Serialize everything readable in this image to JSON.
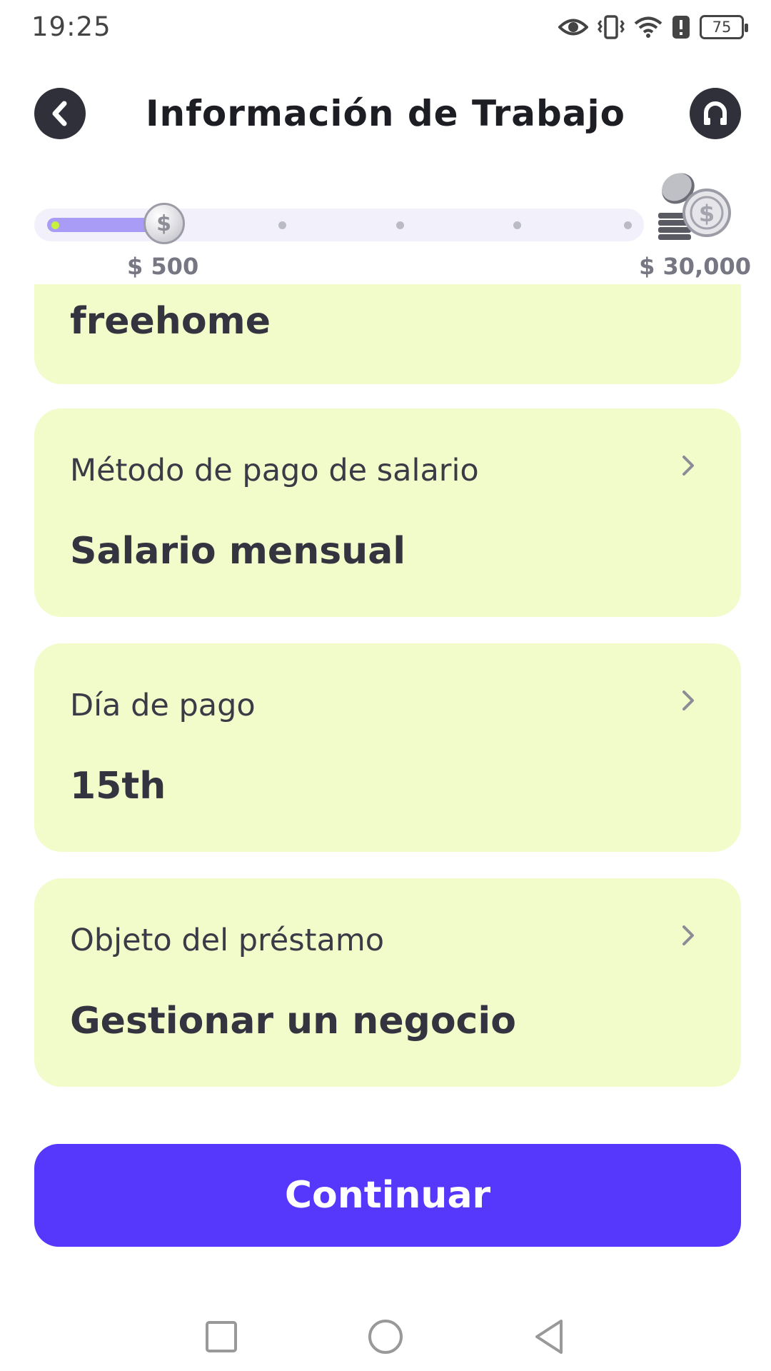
{
  "status_bar": {
    "time": "19:25",
    "battery": "75",
    "icons": [
      "eye-icon",
      "vibrate-icon",
      "wifi-icon",
      "alert-icon",
      "battery-icon"
    ]
  },
  "header": {
    "title": "Información de Trabajo",
    "back_icon": "chevron-left-icon",
    "support_icon": "headset-icon"
  },
  "progress": {
    "min_amount": "$ 500",
    "max_amount": "$ 30,000",
    "current_fraction": 0.2,
    "steps": 5,
    "thumb_symbol": "$"
  },
  "cards": [
    {
      "label": "",
      "value": "freehome"
    },
    {
      "label": "Método de pago de salario",
      "value": "Salario mensual"
    },
    {
      "label": "Día de pago",
      "value": "15th"
    },
    {
      "label": "Objeto del préstamo",
      "value": "Gestionar un negocio"
    }
  ],
  "continue_button": {
    "label": "Continuar"
  },
  "colors": {
    "accent": "#5538fb",
    "card_bg": "#f2fccb",
    "progress_fill": "#a89cf6",
    "progress_track": "#f2f1fb",
    "dark": "#2f3039"
  },
  "nav_bar": {
    "icons": [
      "recent-apps-icon",
      "home-icon",
      "back-icon"
    ]
  }
}
